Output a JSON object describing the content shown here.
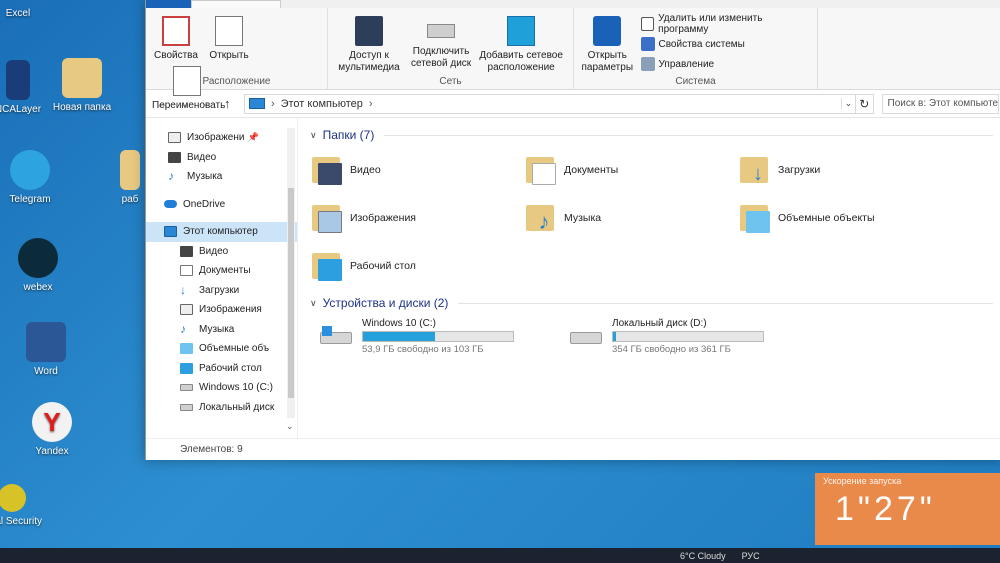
{
  "desktop": {
    "icons": [
      {
        "label": "Excel"
      },
      {
        "label": "NCALayer"
      },
      {
        "label": "Новая папка"
      },
      {
        "label": "Telegram"
      },
      {
        "label": "раб"
      },
      {
        "label": "webex"
      },
      {
        "label": "Word"
      },
      {
        "label": "Yandex"
      },
      {
        "label": "Total Security"
      }
    ]
  },
  "ribbon": {
    "groups": {
      "location": {
        "title": "Расположение",
        "buttons": [
          "Свойства",
          "Открыть",
          "Переименовать"
        ]
      },
      "network": {
        "title": "Сеть",
        "buttons": [
          "Доступ к мультимедиа",
          "Подключить сетевой диск",
          "Добавить сетевое расположение"
        ]
      },
      "system": {
        "title": "Система",
        "open_settings": "Открыть параметры",
        "small": [
          "Удалить или изменить программу",
          "Свойства системы",
          "Управление"
        ]
      }
    },
    "colors": {
      "accent": "#1a62b8"
    }
  },
  "address": {
    "path": "Этот компьютер",
    "search_placeholder": "Поиск в: Этот компьютер"
  },
  "nav": {
    "quick": [
      {
        "label": "Изображени",
        "pinned": true
      },
      {
        "label": "Видео"
      },
      {
        "label": "Музыка"
      }
    ],
    "onedrive": "OneDrive",
    "this_pc": "Этот компьютер",
    "pc_children": [
      "Видео",
      "Документы",
      "Загрузки",
      "Изображения",
      "Музыка",
      "Объемные объ",
      "Рабочий стол",
      "Windows 10 (C:)",
      "Локальный диск"
    ]
  },
  "folders_section": {
    "title": "Папки (7)",
    "items": [
      "Видео",
      "Документы",
      "Загрузки",
      "Изображения",
      "Музыка",
      "Объемные объекты",
      "Рабочий стол"
    ]
  },
  "drives_section": {
    "title": "Устройства и диски (2)",
    "drives": [
      {
        "name": "Windows 10 (C:)",
        "free": "53,9 ГБ свободно из 103 ГБ",
        "used_fraction": 0.48
      },
      {
        "name": "Локальный диск (D:)",
        "free": "354 ГБ свободно из 361 ГБ",
        "used_fraction": 0.02
      }
    ]
  },
  "statusbar": {
    "items_count": "Элементов: 9"
  },
  "widget": {
    "title": "Ускорение запуска",
    "value": "1\"27\""
  },
  "taskbar": {
    "weather": "6°C  Cloudy",
    "lang": "РУС"
  }
}
